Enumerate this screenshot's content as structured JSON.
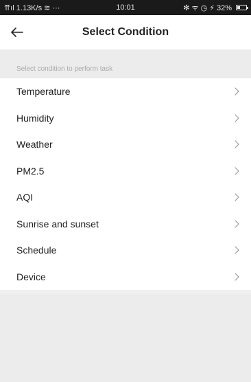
{
  "status_bar": {
    "left": "⇈ıl 1.13K/s ≋ ···",
    "time": "10:01",
    "right": "✻ ᯤ ◷ ⚡ 32%",
    "battery_level": 0.32
  },
  "header": {
    "title": "Select Condition"
  },
  "section": {
    "hint": "Select condition to perform task"
  },
  "conditions": [
    {
      "label": "Temperature"
    },
    {
      "label": "Humidity"
    },
    {
      "label": "Weather"
    },
    {
      "label": "PM2.5"
    },
    {
      "label": "AQI"
    },
    {
      "label": "Sunrise and sunset"
    },
    {
      "label": "Schedule"
    },
    {
      "label": "Device"
    }
  ],
  "colors": {
    "accent_text": "#222222",
    "hint_text": "#aaaaaa",
    "background": "#ececec",
    "status_bar": "#1a1a1a"
  },
  "icons": {
    "back": "arrow-left-icon",
    "row": "chevron-right-icon"
  }
}
